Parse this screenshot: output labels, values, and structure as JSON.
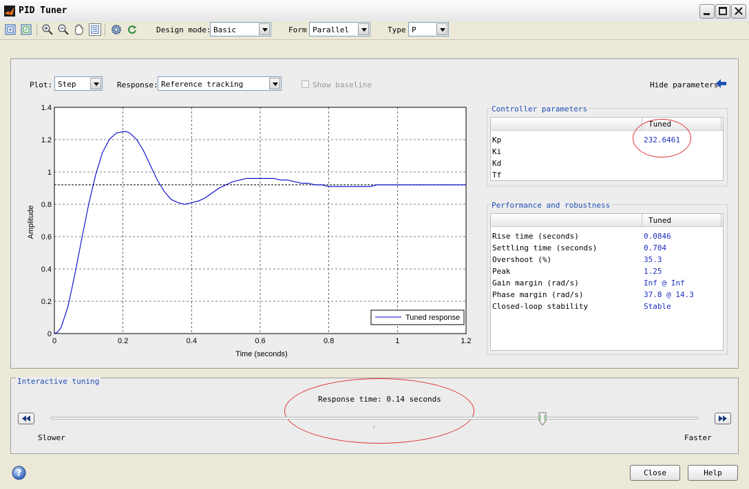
{
  "window": {
    "title": "PID Tuner"
  },
  "toolbar": {
    "design_mode_label": "Design mode:",
    "design_mode_value": "Basic",
    "form_label": "Form",
    "form_value": "Parallel",
    "type_label": "Type",
    "type_value": "P"
  },
  "plot_controls": {
    "plot_label": "Plot:",
    "plot_value": "Step",
    "response_label": "Response:",
    "response_value": "Reference tracking",
    "show_baseline": "Show baseline",
    "hide_parameters": "Hide parameters"
  },
  "chart_data": {
    "type": "line",
    "xlabel": "Time (seconds)",
    "ylabel": "Amplitude",
    "xlim": [
      0,
      1.2
    ],
    "ylim": [
      0,
      1.4
    ],
    "xticks": [
      "0",
      "0.2",
      "0.4",
      "0.6",
      "0.8",
      "1",
      "1.2"
    ],
    "yticks": [
      "0",
      "0.2",
      "0.4",
      "0.6",
      "0.8",
      "1",
      "1.2",
      "1.4"
    ],
    "grid": true,
    "legend": "bottom-right",
    "reference_level": 0.92,
    "series": [
      {
        "name": "Tuned response",
        "color": "#0000cc",
        "x": [
          0,
          0.01,
          0.02,
          0.04,
          0.06,
          0.08,
          0.1,
          0.12,
          0.14,
          0.16,
          0.18,
          0.2,
          0.21,
          0.22,
          0.24,
          0.26,
          0.28,
          0.3,
          0.32,
          0.34,
          0.36,
          0.38,
          0.4,
          0.42,
          0.44,
          0.46,
          0.48,
          0.5,
          0.52,
          0.54,
          0.56,
          0.58,
          0.6,
          0.62,
          0.64,
          0.66,
          0.68,
          0.7,
          0.72,
          0.74,
          0.76,
          0.78,
          0.8,
          0.82,
          0.84,
          0.86,
          0.88,
          0.9,
          0.92,
          0.94,
          0.96,
          0.98,
          1.0,
          1.02,
          1.04,
          1.06,
          1.08,
          1.1,
          1.12,
          1.14,
          1.16,
          1.18,
          1.2
        ],
        "y": [
          0,
          0.01,
          0.04,
          0.17,
          0.37,
          0.59,
          0.8,
          0.98,
          1.12,
          1.2,
          1.24,
          1.25,
          1.25,
          1.24,
          1.2,
          1.13,
          1.04,
          0.95,
          0.88,
          0.83,
          0.81,
          0.8,
          0.81,
          0.82,
          0.84,
          0.87,
          0.9,
          0.92,
          0.94,
          0.95,
          0.96,
          0.96,
          0.96,
          0.96,
          0.96,
          0.95,
          0.95,
          0.94,
          0.93,
          0.93,
          0.92,
          0.92,
          0.91,
          0.91,
          0.91,
          0.91,
          0.91,
          0.91,
          0.91,
          0.92,
          0.92,
          0.92,
          0.92,
          0.92,
          0.92,
          0.92,
          0.92,
          0.92,
          0.92,
          0.92,
          0.92,
          0.92,
          0.92
        ]
      }
    ]
  },
  "controller_parameters": {
    "title": "Controller parameters",
    "column": "Tuned",
    "rows": [
      {
        "name": "Kp",
        "value": "232.6461"
      },
      {
        "name": "Ki",
        "value": ""
      },
      {
        "name": "Kd",
        "value": ""
      },
      {
        "name": "Tf",
        "value": ""
      }
    ]
  },
  "performance": {
    "title": "Performance and robustness",
    "column": "Tuned",
    "rows": [
      {
        "name": "Rise time (seconds)",
        "value": "0.0846"
      },
      {
        "name": "Settling time (seconds)",
        "value": "0.704"
      },
      {
        "name": "Overshoot (%)",
        "value": "35.3"
      },
      {
        "name": "Peak",
        "value": "1.25"
      },
      {
        "name": "Gain margin (rad/s)",
        "value": "Inf @ Inf"
      },
      {
        "name": "Phase margin (rad/s)",
        "value": "37.8 @ 14.3"
      },
      {
        "name": "Closed-loop stability",
        "value": "Stable"
      }
    ]
  },
  "interactive_tuning": {
    "title": "Interactive tuning",
    "response_time": "Response time: 0.14 seconds",
    "slider_value": 0.76,
    "slower": "Slower",
    "faster": "Faster"
  },
  "buttons": {
    "close": "Close",
    "help": "Help"
  },
  "colors": {
    "annotation": "#e03030",
    "accent_blue": "#1f4fb5",
    "curve": "#0000cc"
  }
}
